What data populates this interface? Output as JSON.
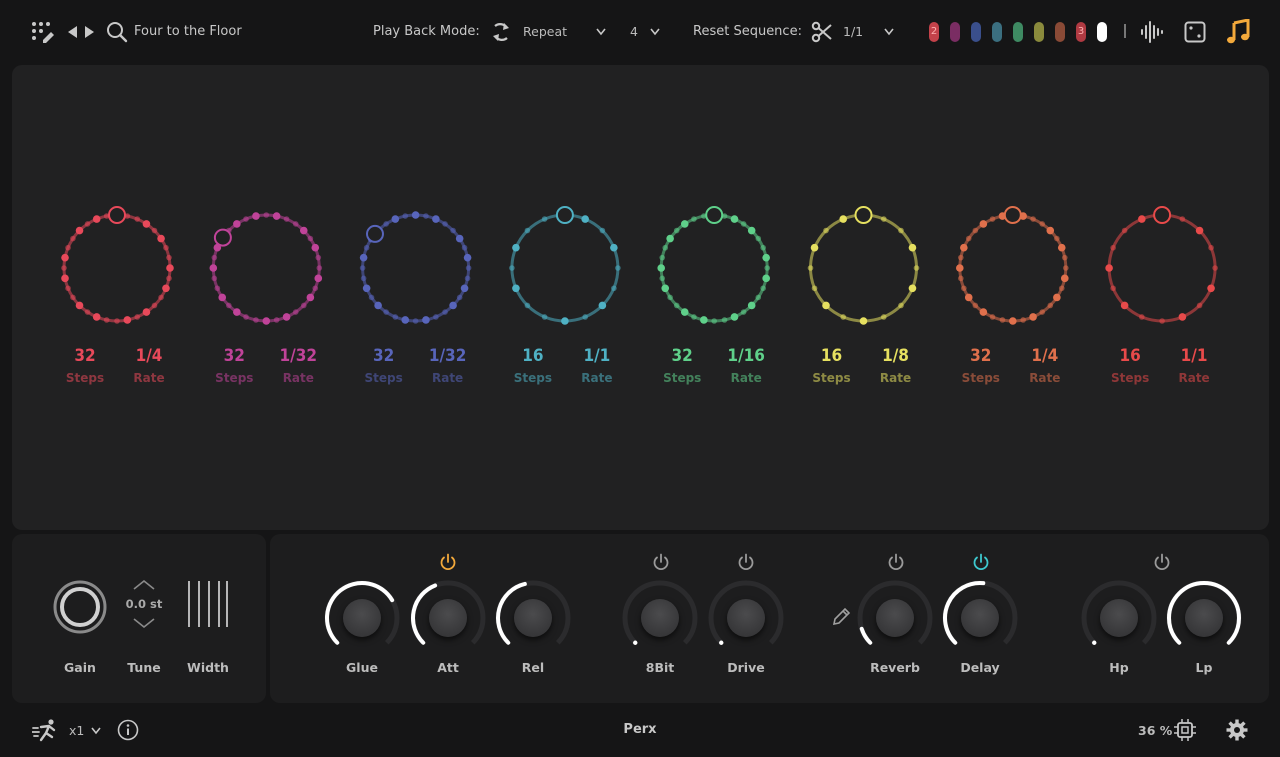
{
  "header": {
    "preset_name": "Four to the Floor",
    "playback_mode_label": "Play Back Mode:",
    "playback_mode_value": "Repeat",
    "repeat_count": "4",
    "reset_sequence_label": "Reset Sequence:",
    "reset_sequence_value": "1/1",
    "pills": [
      {
        "color": "#c4424a",
        "label": "2"
      },
      {
        "color": "#7a2d63",
        "label": ""
      },
      {
        "color": "#3a4f8c",
        "label": ""
      },
      {
        "color": "#3b6f80",
        "label": ""
      },
      {
        "color": "#3e8a62",
        "label": ""
      },
      {
        "color": "#8a8a3c",
        "label": ""
      },
      {
        "color": "#8a4a36",
        "label": ""
      },
      {
        "color": "#b03a42",
        "label": "3"
      },
      {
        "color": "#ffffff",
        "label": ""
      }
    ],
    "accent_color": "#f3a93b"
  },
  "tracks": [
    {
      "color": "#e8495a",
      "steps": "32",
      "rate": "1/4",
      "steps_caption": "Steps",
      "rate_caption": "Rate"
    },
    {
      "color": "#c04399",
      "steps": "32",
      "rate": "1/32",
      "steps_caption": "Steps",
      "rate_caption": "Rate"
    },
    {
      "color": "#5865bb",
      "steps": "32",
      "rate": "1/32",
      "steps_caption": "Steps",
      "rate_caption": "Rate"
    },
    {
      "color": "#4fb1c4",
      "steps": "16",
      "rate": "1/1",
      "steps_caption": "Steps",
      "rate_caption": "Rate"
    },
    {
      "color": "#5fd08a",
      "steps": "32",
      "rate": "1/16",
      "steps_caption": "Steps",
      "rate_caption": "Rate"
    },
    {
      "color": "#e6e060",
      "steps": "16",
      "rate": "1/8",
      "steps_caption": "Steps",
      "rate_caption": "Rate"
    },
    {
      "color": "#e0704c",
      "steps": "32",
      "rate": "1/4",
      "steps_caption": "Steps",
      "rate_caption": "Rate"
    },
    {
      "color": "#e84a4a",
      "steps": "16",
      "rate": "1/1",
      "steps_caption": "Steps",
      "rate_caption": "Rate"
    }
  ],
  "voice": {
    "gain_label": "Gain",
    "tune_label": "Tune",
    "tune_value": "0.0 st",
    "width_label": "Width"
  },
  "fx": {
    "knobs": [
      {
        "label": "Glue",
        "value": 0.72
      },
      {
        "label": "Att",
        "value": 0.42
      },
      {
        "label": "Rel",
        "value": 0.45
      },
      {
        "label": "8Bit",
        "value": 0.0
      },
      {
        "label": "Drive",
        "value": 0.0
      },
      {
        "label": "Reverb",
        "value": 0.1
      },
      {
        "label": "Delay",
        "value": 0.52
      },
      {
        "label": "Hp",
        "value": 0.0
      },
      {
        "label": "Lp",
        "value": 1.0
      }
    ],
    "power_colors": {
      "compressor": "#f3a93b",
      "bitcrush": "#9a9a9a",
      "drive": "#9a9a9a",
      "reverb": "#9a9a9a",
      "delay": "#3ec9cf",
      "filter": "#9a9a9a"
    }
  },
  "footer": {
    "speed": "x1",
    "kit_name": "Perx",
    "cpu": "36 %"
  }
}
